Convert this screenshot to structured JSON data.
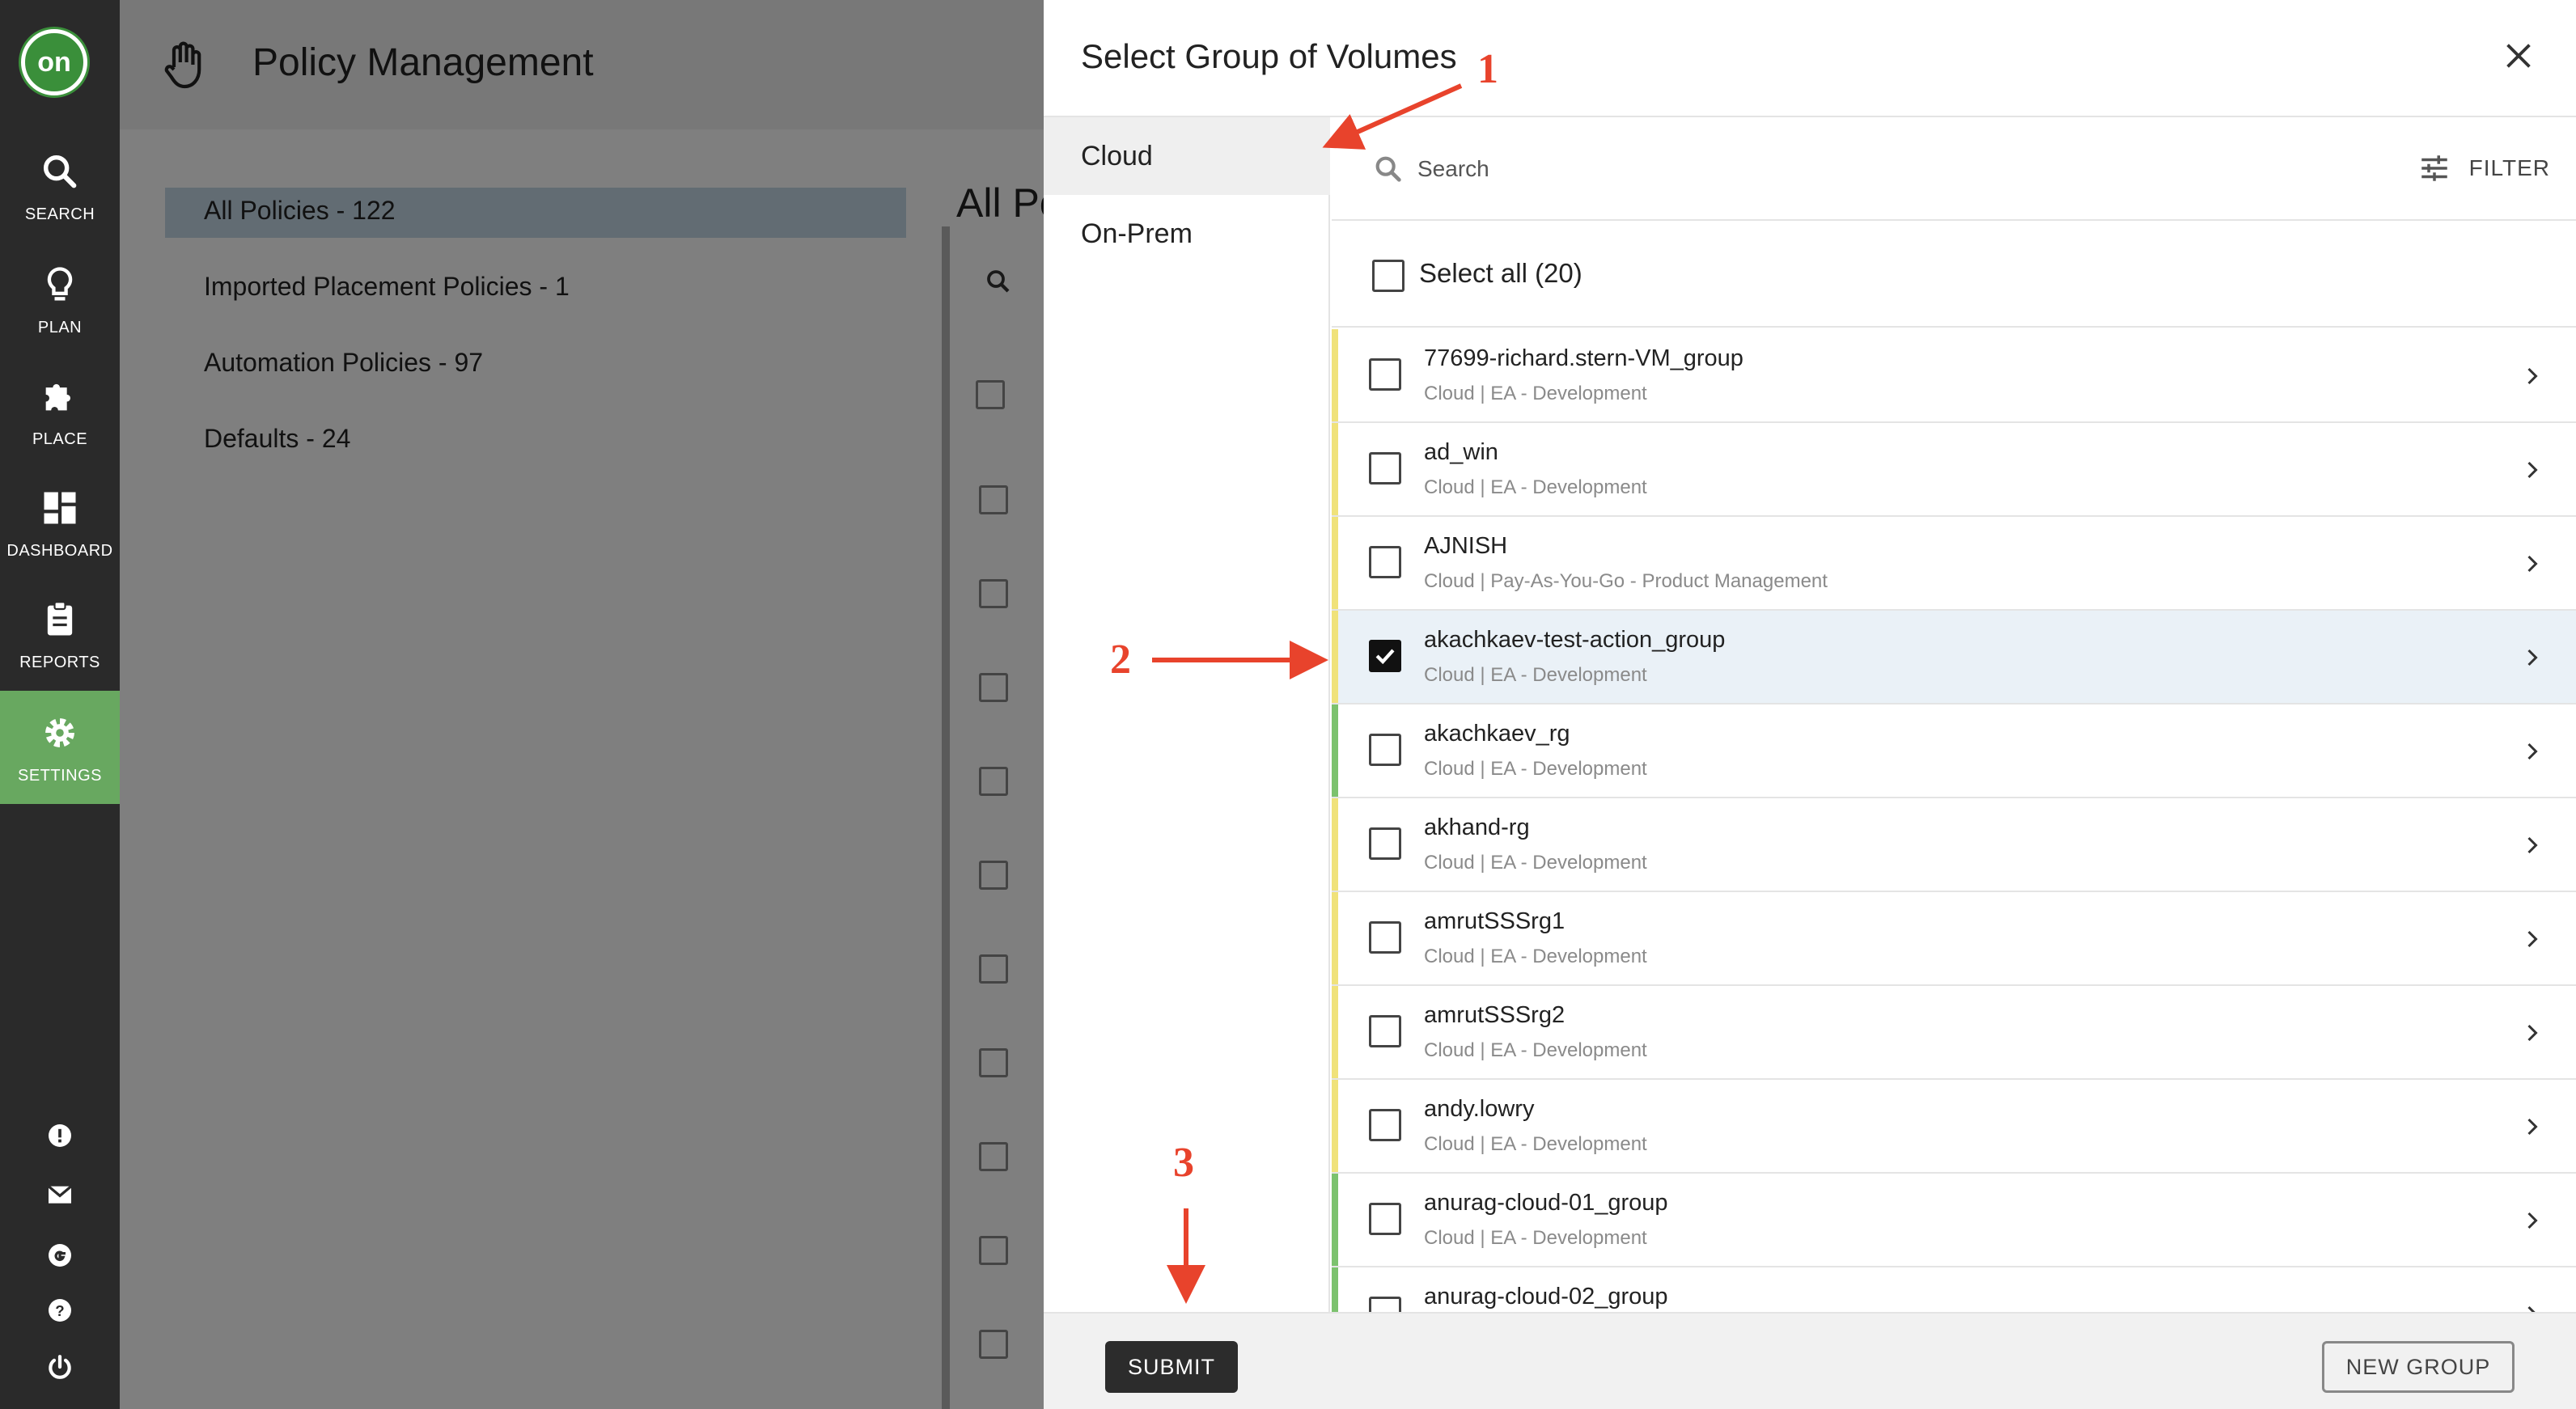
{
  "nav": {
    "logo": "on",
    "items": [
      {
        "label": "SEARCH",
        "icon": "search-icon"
      },
      {
        "label": "PLAN",
        "icon": "lightbulb-icon"
      },
      {
        "label": "PLACE",
        "icon": "puzzle-icon"
      },
      {
        "label": "DASHBOARD",
        "icon": "dashboard-icon"
      },
      {
        "label": "REPORTS",
        "icon": "clipboard-icon"
      },
      {
        "label": "SETTINGS",
        "icon": "gear-icon",
        "active": true
      }
    ],
    "bottom_icons": [
      "alert-icon",
      "mail-icon",
      "google-icon",
      "help-icon",
      "power-icon"
    ]
  },
  "background": {
    "title": "Policy Management",
    "list": [
      "All Policies - 122",
      "Imported Placement Policies - 1",
      "Automation Policies - 97",
      "Defaults - 24"
    ],
    "partial_heading": "All Po"
  },
  "modal": {
    "title": "Select Group of Volumes",
    "categories": [
      {
        "label": "Cloud",
        "active": true
      },
      {
        "label": "On-Prem",
        "active": false
      }
    ],
    "search_placeholder": "Search",
    "filter_label": "FILTER",
    "select_all_label": "Select all (20)",
    "groups": [
      {
        "name": "77699-richard.stern-VM_group",
        "meta": "Cloud  |  EA - Development",
        "stripe": "#f0e27a",
        "checked": false
      },
      {
        "name": "ad_win",
        "meta": "Cloud  |  EA - Development",
        "stripe": "#f0e27a",
        "checked": false
      },
      {
        "name": "AJNISH",
        "meta": "Cloud  |  Pay-As-You-Go - Product Management",
        "stripe": "#f0e27a",
        "checked": false
      },
      {
        "name": "akachkaev-test-action_group",
        "meta": "Cloud  |  EA - Development",
        "stripe": "#f0e27a",
        "checked": true
      },
      {
        "name": "akachkaev_rg",
        "meta": "Cloud  |  EA - Development",
        "stripe": "#7cc26e",
        "checked": false
      },
      {
        "name": "akhand-rg",
        "meta": "Cloud  |  EA - Development",
        "stripe": "#f0e27a",
        "checked": false
      },
      {
        "name": "amrutSSSrg1",
        "meta": "Cloud  |  EA - Development",
        "stripe": "#f0e27a",
        "checked": false
      },
      {
        "name": "amrutSSSrg2",
        "meta": "Cloud  |  EA - Development",
        "stripe": "#f0e27a",
        "checked": false
      },
      {
        "name": "andy.lowry",
        "meta": "Cloud  |  EA - Development",
        "stripe": "#f0e27a",
        "checked": false
      },
      {
        "name": "anurag-cloud-01_group",
        "meta": "Cloud  |  EA - Development",
        "stripe": "#7cc26e",
        "checked": false
      },
      {
        "name": "anurag-cloud-02_group",
        "meta": "",
        "stripe": "#7cc26e",
        "checked": false
      }
    ],
    "submit_label": "SUBMIT",
    "new_group_label": "NEW GROUP"
  },
  "annotations": [
    "1",
    "2",
    "3"
  ],
  "colors": {
    "accent": "#e8432c",
    "nav_bg": "#2a2a2a",
    "nav_active": "#68a860",
    "selected_row": "#eaf1f7"
  }
}
